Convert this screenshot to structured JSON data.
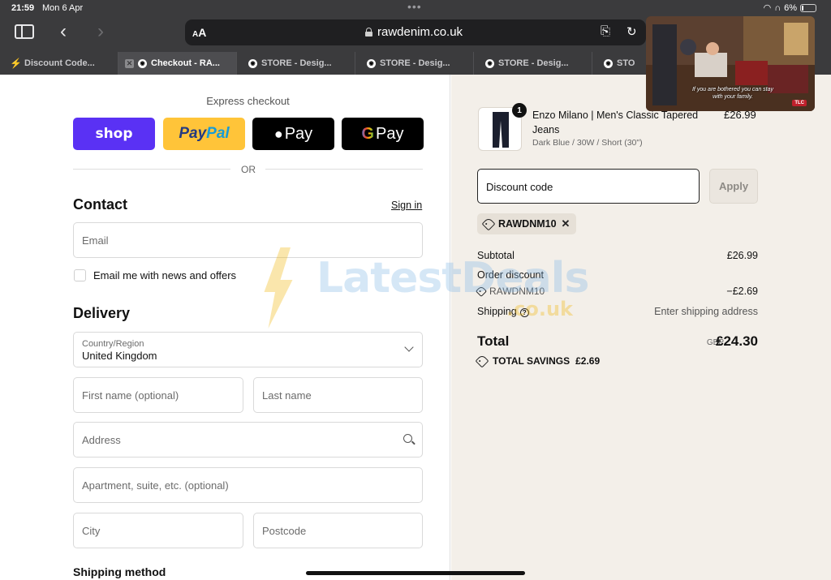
{
  "status": {
    "time": "21:59",
    "date": "Mon 6 Apr",
    "battery": "6%"
  },
  "browser": {
    "text_size": "AA",
    "url": "rawdenim.co.uk",
    "tabs": [
      {
        "label": "Discount Code...",
        "active": false
      },
      {
        "label": "Checkout - RA...",
        "active": true
      },
      {
        "label": "STORE - Desig...",
        "active": false
      },
      {
        "label": "STORE - Desig...",
        "active": false
      },
      {
        "label": "STORE - Desig...",
        "active": false
      },
      {
        "label": "STO",
        "active": false
      }
    ]
  },
  "pip": {
    "caption": "If you are bothered you can stay with your family.",
    "logo": "TLC"
  },
  "express": {
    "title": "Express checkout",
    "shop": "shop",
    "paypal_a": "Pay",
    "paypal_b": "Pal",
    "applepay": "Pay",
    "gpay_g": "G",
    "gpay": "Pay",
    "or": "OR"
  },
  "contact": {
    "title": "Contact",
    "sign_in": "Sign in",
    "email_placeholder": "Email",
    "newsletter_label": "Email me with news and offers"
  },
  "delivery": {
    "title": "Delivery",
    "country_label": "Country/Region",
    "country_value": "United Kingdom",
    "first_name_placeholder": "First name (optional)",
    "last_name_placeholder": "Last name",
    "address_placeholder": "Address",
    "apartment_placeholder": "Apartment, suite, etc. (optional)",
    "city_placeholder": "City",
    "postcode_placeholder": "Postcode"
  },
  "shipping_method": {
    "title": "Shipping method"
  },
  "order": {
    "quantity": "1",
    "product_name": "Enzo Milano | Men's Classic Tapered Jeans",
    "variant": "Dark Blue / 30W / Short (30\")",
    "price": "£26.99",
    "discount_placeholder": "Discount code",
    "apply_label": "Apply",
    "applied_code": "RAWDNM10",
    "subtotal_label": "Subtotal",
    "subtotal_value": "£26.99",
    "order_discount_label": "Order discount",
    "order_discount_code": "RAWDNM10",
    "order_discount_value": "−£2.69",
    "shipping_label": "Shipping",
    "shipping_value": "Enter shipping address",
    "total_label": "Total",
    "currency": "GBP",
    "total_value": "£24.30",
    "savings_label": "TOTAL SAVINGS",
    "savings_value": "£2.69"
  },
  "watermark": {
    "main": "LatestDeals",
    "sub": ".co.uk"
  },
  "colors": {
    "shop": "#5a31f4",
    "paypal": "#ffc439",
    "summary_bg": "#f3efe9",
    "chrome": "#3b3b3d"
  }
}
